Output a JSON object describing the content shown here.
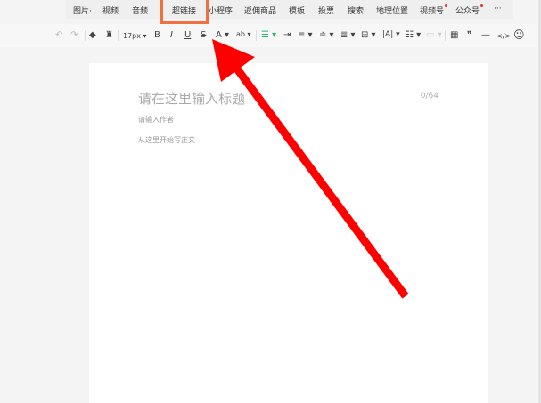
{
  "menu": {
    "items": [
      {
        "label": "图片·",
        "dot": false
      },
      {
        "label": "视频",
        "dot": false
      },
      {
        "label": "音频",
        "dot": false
      },
      {
        "label": "超链接",
        "dot": false
      },
      {
        "label": "小程序",
        "dot": false
      },
      {
        "label": "返佣商品",
        "dot": false
      },
      {
        "label": "模板",
        "dot": false
      },
      {
        "label": "投票",
        "dot": false
      },
      {
        "label": "搜索",
        "dot": false
      },
      {
        "label": "地理位置",
        "dot": false
      },
      {
        "label": "视频号",
        "dot": true
      },
      {
        "label": "公众号",
        "dot": true
      },
      {
        "label": "···",
        "dot": false
      }
    ],
    "highlighted": "超链接",
    "highlight_color": "#f07040"
  },
  "toolbar": {
    "undo": "↶",
    "redo": "↷",
    "eraser": "◆",
    "format_painter": "♜",
    "font_size": "17px ▾",
    "bold": "B",
    "italic": "I",
    "underline": "U",
    "strike": "S",
    "font_color": "A ▾",
    "bg_color": "ab ▾",
    "align": "☰ ▾",
    "indent": "⇥",
    "line_spacing": "≡ ▾",
    "para_spacing": "≐ ▾",
    "align2": "≣ ▾",
    "margins": "⊟ ▾",
    "letter_spacing": "|A| ▾",
    "list": "☷ ▾",
    "disabled": "▭ ▾",
    "table": "▦",
    "quote": "❞",
    "hr": "—",
    "code": "</>",
    "emoji": "☺"
  },
  "editor": {
    "title_placeholder": "请在这里输入标题",
    "title_count": "0/64",
    "author_placeholder": "请输入作者",
    "body_placeholder": "从这里开始写正文"
  },
  "annotation": {
    "arrow_color": "#ff0000"
  }
}
